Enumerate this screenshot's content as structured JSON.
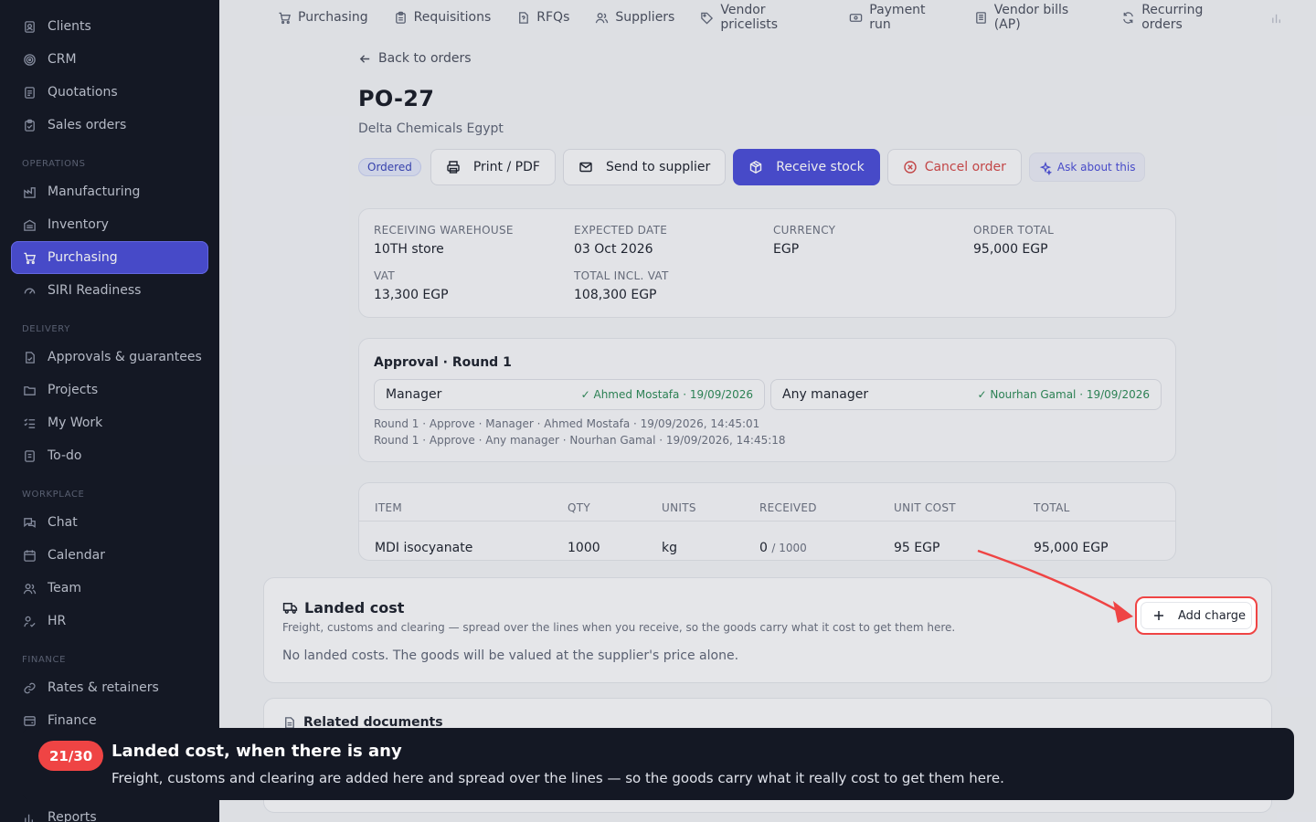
{
  "sidebar": {
    "sections": [
      {
        "label": "Operations"
      },
      {
        "label": "Delivery"
      },
      {
        "label": "Workplace"
      },
      {
        "label": "Finance"
      }
    ],
    "items": [
      {
        "label": "Clients",
        "icon": "clients-icon"
      },
      {
        "label": "CRM",
        "icon": "crm-icon"
      },
      {
        "label": "Quotations",
        "icon": "quotations-icon"
      },
      {
        "label": "Sales orders",
        "icon": "sales-orders-icon"
      },
      {
        "label": "Manufacturing",
        "icon": "factory-icon"
      },
      {
        "label": "Inventory",
        "icon": "inventory-icon"
      },
      {
        "label": "Purchasing",
        "icon": "cart-icon",
        "active": true
      },
      {
        "label": "SIRI Readiness",
        "icon": "gauge-icon"
      },
      {
        "label": "Approvals & guarantees",
        "icon": "approval-doc-icon"
      },
      {
        "label": "Projects",
        "icon": "folder-icon"
      },
      {
        "label": "My Work",
        "icon": "tasks-icon"
      },
      {
        "label": "To-do",
        "icon": "todo-icon"
      },
      {
        "label": "Chat",
        "icon": "chat-icon"
      },
      {
        "label": "Calendar",
        "icon": "calendar-icon"
      },
      {
        "label": "Team",
        "icon": "team-icon"
      },
      {
        "label": "HR",
        "icon": "hr-icon"
      },
      {
        "label": "Rates & retainers",
        "icon": "rates-icon"
      },
      {
        "label": "Finance",
        "icon": "finance-icon"
      },
      {
        "label": "Reports",
        "icon": "reports-icon"
      }
    ]
  },
  "topnav": {
    "items": [
      {
        "label": "Purchasing",
        "icon": "cart-icon"
      },
      {
        "label": "Requisitions",
        "icon": "clipboard-icon"
      },
      {
        "label": "RFQs",
        "icon": "rfq-doc-icon"
      },
      {
        "label": "Suppliers",
        "icon": "suppliers-icon"
      },
      {
        "label": "Vendor pricelists",
        "icon": "tag-icon"
      },
      {
        "label": "Payment run",
        "icon": "payment-icon"
      },
      {
        "label": "Vendor bills (AP)",
        "icon": "bill-icon"
      },
      {
        "label": "Recurring orders",
        "icon": "recurring-icon"
      }
    ]
  },
  "order": {
    "back_label": "Back to orders",
    "number": "PO-27",
    "supplier": "Delta Chemicals Egypt",
    "status": "Ordered",
    "actions": {
      "print": "Print / PDF",
      "send": "Send to supplier",
      "receive": "Receive stock",
      "cancel": "Cancel order",
      "ask": "Ask about this"
    },
    "summary": {
      "warehouse_label": "Receiving warehouse",
      "warehouse": "10TH store",
      "expected_label": "Expected date",
      "expected": "03 Oct 2026",
      "currency_label": "Currency",
      "currency": "EGP",
      "total_label": "Order total",
      "total": "95,000 EGP",
      "vat_label": "VAT",
      "vat": "13,300 EGP",
      "total_incl_label": "Total incl. VAT",
      "total_incl": "108,300 EGP"
    },
    "approval": {
      "title": "Approval · Round 1",
      "steps": [
        {
          "role": "Manager",
          "approved": "✓ Ahmed Mostafa · 19/09/2026"
        },
        {
          "role": "Any manager",
          "approved": "✓ Nourhan Gamal · 19/09/2026"
        }
      ],
      "log": [
        "Round 1 · Approve · Manager · Ahmed Mostafa · 19/09/2026, 14:45:01",
        "Round 1 · Approve · Any manager · Nourhan Gamal · 19/09/2026, 14:45:18"
      ]
    },
    "lines": {
      "headers": [
        "Item",
        "Qty",
        "Units",
        "Received",
        "Unit cost",
        "Total"
      ],
      "rows": [
        {
          "item": "MDI isocyanate",
          "qty": "1000",
          "units": "kg",
          "received": "0",
          "received_of": "/ 1000",
          "unit_cost": "95 EGP",
          "total": "95,000 EGP"
        }
      ]
    },
    "landed_cost": {
      "title": "Landed cost",
      "description": "Freight, customs and clearing — spread over the lines when you receive, so the goods carry what it cost to get them here.",
      "empty": "No landed costs. The goods will be valued at the supplier's price alone.",
      "add_label": "Add charge"
    },
    "related": {
      "title": "Related documents"
    }
  },
  "tour": {
    "step": "21/30",
    "title": "Landed cost, when there is any",
    "body": "Freight, customs and clearing are added here and spread over the lines — so the goods carry what it really cost to get them here."
  },
  "colors": {
    "accent": "#4b4fd6",
    "sidebar_bg": "#141824",
    "highlight": "#ef4444",
    "approved": "#2e8a58"
  }
}
